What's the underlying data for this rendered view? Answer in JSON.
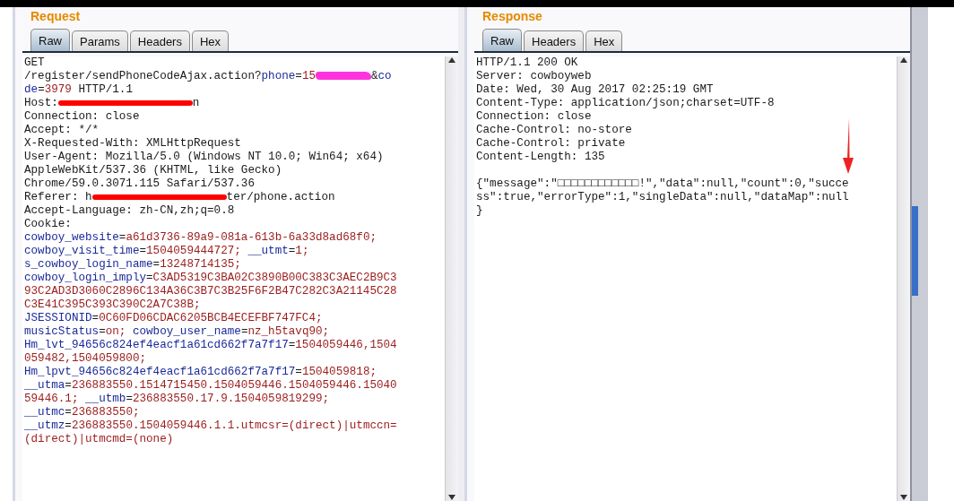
{
  "request": {
    "title": "Request",
    "tabs": [
      {
        "label": "Raw",
        "selected": true
      },
      {
        "label": "Params",
        "selected": false
      },
      {
        "label": "Headers",
        "selected": false
      },
      {
        "label": "Hex",
        "selected": false
      }
    ],
    "lines": [
      [
        {
          "kind": "plain",
          "text": "GET"
        }
      ],
      [
        {
          "kind": "plain",
          "text": "/register/sendPhoneCodeAjax.action?"
        },
        {
          "kind": "key",
          "text": "phone"
        },
        {
          "kind": "plain",
          "text": "="
        },
        {
          "kind": "value",
          "text": "15"
        },
        {
          "kind": "scribble",
          "color": "#ff33dd"
        },
        {
          "kind": "plain",
          "text": "&"
        },
        {
          "kind": "key",
          "text": "co"
        }
      ],
      [
        {
          "kind": "key",
          "text": "de"
        },
        {
          "kind": "plain",
          "text": "="
        },
        {
          "kind": "value",
          "text": "3979"
        },
        {
          "kind": "plain",
          "text": " HTTP/1.1"
        }
      ],
      [
        {
          "kind": "plain",
          "text": "Host:"
        },
        {
          "kind": "redacted",
          "color": "#ff0000"
        },
        {
          "kind": "plain",
          "text": "n"
        }
      ],
      [
        {
          "kind": "plain",
          "text": "Connection: close"
        }
      ],
      [
        {
          "kind": "plain",
          "text": "Accept: */*"
        }
      ],
      [
        {
          "kind": "plain",
          "text": "X-Requested-With: XMLHttpRequest"
        }
      ],
      [
        {
          "kind": "plain",
          "text": "User-Agent: Mozilla/5.0 (Windows NT 10.0; Win64; x64)"
        }
      ],
      [
        {
          "kind": "plain",
          "text": "AppleWebKit/537.36 (KHTML, like Gecko)"
        }
      ],
      [
        {
          "kind": "plain",
          "text": "Chrome/59.0.3071.115 Safari/537.36"
        }
      ],
      [
        {
          "kind": "plain",
          "text": "Referer: h"
        },
        {
          "kind": "redacted",
          "color": "#ff0000"
        },
        {
          "kind": "plain",
          "text": "ter/phone.action"
        }
      ],
      [
        {
          "kind": "plain",
          "text": "Accept-Language: zh-CN,zh;q=0.8"
        }
      ],
      [
        {
          "kind": "plain",
          "text": "Cookie:"
        }
      ],
      [
        {
          "kind": "key",
          "text": "cowboy_website"
        },
        {
          "kind": "plain",
          "text": "="
        },
        {
          "kind": "value",
          "text": "a61d3736-89a9-081a-613b-6a33d8ad68f0;"
        }
      ],
      [
        {
          "kind": "key",
          "text": "cowboy_visit_time"
        },
        {
          "kind": "plain",
          "text": "="
        },
        {
          "kind": "value",
          "text": "1504059444727;"
        },
        {
          "kind": "key",
          "text": " __utmt"
        },
        {
          "kind": "plain",
          "text": "="
        },
        {
          "kind": "value",
          "text": "1;"
        }
      ],
      [
        {
          "kind": "key",
          "text": "s_cowboy_login_name"
        },
        {
          "kind": "plain",
          "text": "="
        },
        {
          "kind": "value",
          "text": "13248714135;"
        }
      ],
      [
        {
          "kind": "key",
          "text": "cowboy_login_imply"
        },
        {
          "kind": "plain",
          "text": "="
        },
        {
          "kind": "value",
          "text": "C3AD5319C3BA02C3890B00C383C3AEC2B9C3"
        }
      ],
      [
        {
          "kind": "value",
          "text": "93C2AD3D3060C2896C134A36C3B7C3B25F6F2B47C282C3A21145C28"
        }
      ],
      [
        {
          "kind": "value",
          "text": "C3E41C395C393C390C2A7C38B;"
        }
      ],
      [
        {
          "kind": "key",
          "text": "JSESSIONID"
        },
        {
          "kind": "plain",
          "text": "="
        },
        {
          "kind": "value",
          "text": "0C60FD06CDAC6205BCB4ECEFBF747FC4;"
        }
      ],
      [
        {
          "kind": "key",
          "text": "musicStatus"
        },
        {
          "kind": "plain",
          "text": "="
        },
        {
          "kind": "value",
          "text": "on;"
        },
        {
          "kind": "key",
          "text": " cowboy_user_name"
        },
        {
          "kind": "plain",
          "text": "="
        },
        {
          "kind": "value",
          "text": "nz_h5tavq90;"
        }
      ],
      [
        {
          "kind": "key",
          "text": "Hm_lvt_94656c824ef4eacf1a61cd662f7a7f17"
        },
        {
          "kind": "plain",
          "text": "="
        },
        {
          "kind": "value",
          "text": "1504059446,1504"
        }
      ],
      [
        {
          "kind": "value",
          "text": "059482,1504059800;"
        }
      ],
      [
        {
          "kind": "key",
          "text": "Hm_lpvt_94656c824ef4eacf1a61cd662f7a7f17"
        },
        {
          "kind": "plain",
          "text": "="
        },
        {
          "kind": "value",
          "text": "1504059818;"
        }
      ],
      [
        {
          "kind": "key",
          "text": "__utma"
        },
        {
          "kind": "plain",
          "text": "="
        },
        {
          "kind": "value",
          "text": "236883550.1514715450.1504059446.1504059446.15040"
        }
      ],
      [
        {
          "kind": "value",
          "text": "59446.1;"
        },
        {
          "kind": "key",
          "text": " __utmb"
        },
        {
          "kind": "plain",
          "text": "="
        },
        {
          "kind": "value",
          "text": "236883550.17.9.1504059819299;"
        }
      ],
      [
        {
          "kind": "key",
          "text": "__utmc"
        },
        {
          "kind": "plain",
          "text": "="
        },
        {
          "kind": "value",
          "text": "236883550;"
        }
      ],
      [
        {
          "kind": "key",
          "text": "__utmz"
        },
        {
          "kind": "plain",
          "text": "="
        },
        {
          "kind": "value",
          "text": "236883550.1504059446.1.1.utmcsr=(direct)|utmccn="
        }
      ],
      [
        {
          "kind": "value",
          "text": "(direct)|utmcmd=(none)"
        }
      ]
    ]
  },
  "response": {
    "title": "Response",
    "tabs": [
      {
        "label": "Raw",
        "selected": true
      },
      {
        "label": "Headers",
        "selected": false
      },
      {
        "label": "Hex",
        "selected": false
      }
    ],
    "lines": [
      [
        {
          "kind": "plain",
          "text": "HTTP/1.1 200 OK"
        }
      ],
      [
        {
          "kind": "plain",
          "text": "Server: cowboyweb"
        }
      ],
      [
        {
          "kind": "plain",
          "text": "Date: Wed, 30 Aug 2017 02:25:19 GMT"
        }
      ],
      [
        {
          "kind": "plain",
          "text": "Content-Type: application/json;charset=UTF-8"
        }
      ],
      [
        {
          "kind": "plain",
          "text": "Connection: close"
        }
      ],
      [
        {
          "kind": "plain",
          "text": "Cache-Control: no-store"
        }
      ],
      [
        {
          "kind": "plain",
          "text": "Cache-Control: private"
        }
      ],
      [
        {
          "kind": "plain",
          "text": "Content-Length: 135"
        }
      ]
    ],
    "body_lines": [
      [
        {
          "kind": "plain",
          "text": "{\"message\":\"□□□□□□□□□□□□!\",\"data\":null,\"count\":0,\"succe"
        }
      ],
      [
        {
          "kind": "plain",
          "text": "ss\":true,\"errorType\":1,\"singleData\":null,\"dataMap\":null"
        }
      ],
      [
        {
          "kind": "plain",
          "text": "}"
        }
      ]
    ]
  }
}
